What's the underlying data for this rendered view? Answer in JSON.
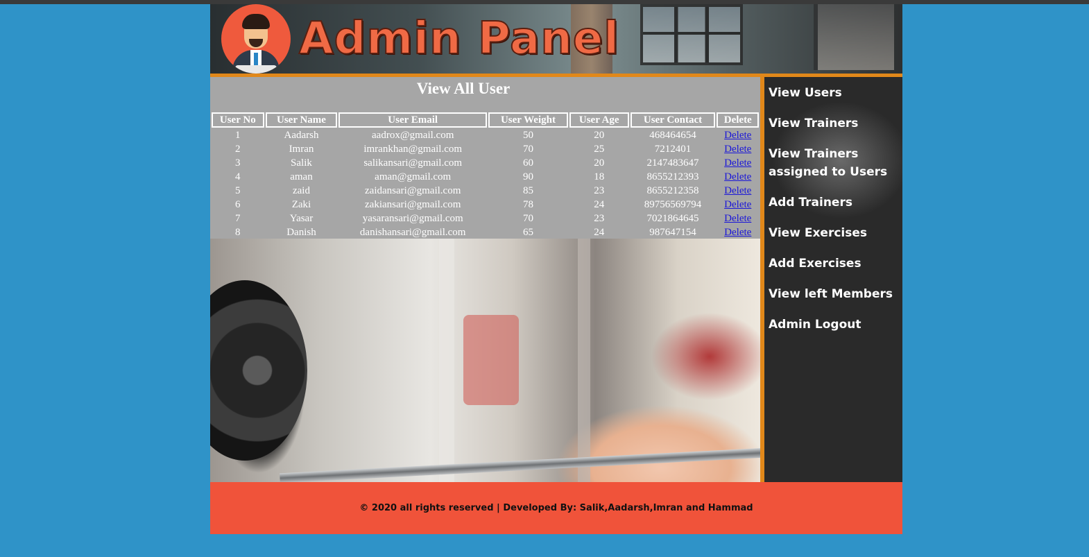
{
  "header": {
    "logo_text": "Admin Panel"
  },
  "page": {
    "title": "View All User"
  },
  "table": {
    "columns": [
      "User No",
      "User Name",
      "User Email",
      "User Weight",
      "User Age",
      "User Contact",
      "Delete"
    ],
    "rows": [
      [
        "1",
        "Aadarsh",
        "aadrox@gmail.com",
        "50",
        "20",
        "468464654",
        "Delete"
      ],
      [
        "2",
        "Imran",
        "imrankhan@gmail.com",
        "70",
        "25",
        "7212401",
        "Delete"
      ],
      [
        "3",
        "Salik",
        "salikansari@gmail.com",
        "60",
        "20",
        "2147483647",
        "Delete"
      ],
      [
        "4",
        "aman",
        "aman@gmail.com",
        "90",
        "18",
        "8655212393",
        "Delete"
      ],
      [
        "5",
        "zaid",
        "zaidansari@gmail.com",
        "85",
        "23",
        "8655212358",
        "Delete"
      ],
      [
        "6",
        "Zaki",
        "zakiansari@gmail.com",
        "78",
        "24",
        "89756569794",
        "Delete"
      ],
      [
        "7",
        "Yasar",
        "yasaransari@gmail.com",
        "70",
        "23",
        "7021864645",
        "Delete"
      ],
      [
        "8",
        "Danish",
        "danishansari@gmail.com",
        "65",
        "24",
        "987647154",
        "Delete"
      ]
    ]
  },
  "sidebar": {
    "items": [
      "View Users",
      "View Trainers",
      "View Trainers assigned to Users",
      "Add Trainers",
      "View Exercises",
      "Add Exercises",
      "View left Members",
      "Admin Logout"
    ]
  },
  "footer": {
    "text": "© 2020 all rights reserved | Developed By: Salik,Aadarsh,Imran and Hammad"
  },
  "colors": {
    "page_bg": "#2f93c8",
    "accent_border": "#e1881a",
    "footer_bg": "#f0533a",
    "table_bg": "#a6a6a6",
    "link": "#1a16d8"
  }
}
